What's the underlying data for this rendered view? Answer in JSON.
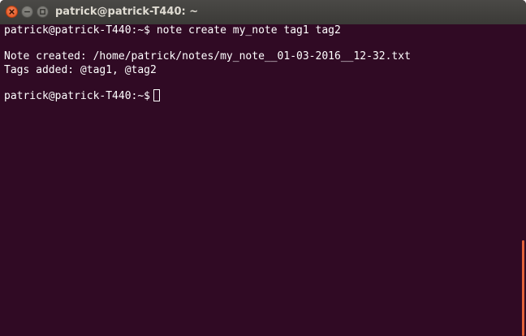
{
  "window": {
    "title": "patrick@patrick-T440: ~"
  },
  "colors": {
    "terminal_background": "#300a24",
    "titlebar": "#3c3b37",
    "close_button": "#df4a16",
    "scrollbar_thumb": "#e2633c",
    "text": "#ffffff"
  },
  "icons": {
    "close": "close-icon",
    "minimize": "minimize-icon",
    "maximize": "maximize-icon"
  },
  "terminal": {
    "prompt": "patrick@patrick-T440:~$",
    "command": " note create my_note tag1 tag2",
    "output_note_created": "Note created: /home/patrick/notes/my_note__01-03-2016__12-32.txt",
    "output_tags_added": "Tags added: @tag1, @tag2",
    "current_prompt": "patrick@patrick-T440:~$"
  },
  "scrollbar": {
    "position": "bottom"
  }
}
